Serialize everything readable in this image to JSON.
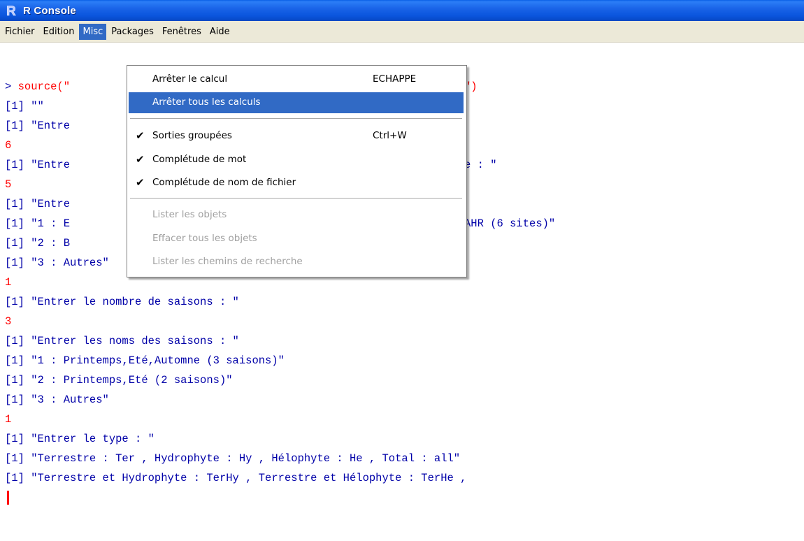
{
  "window": {
    "title": "R Console",
    "icon": "r-logo-icon"
  },
  "menubar": {
    "items": [
      {
        "label": "Fichier"
      },
      {
        "label": "Edition"
      },
      {
        "label": "Misc"
      },
      {
        "label": "Packages"
      },
      {
        "label": "Fenêtres"
      },
      {
        "label": "Aide"
      }
    ]
  },
  "misc_menu": {
    "items": [
      {
        "label": "Arrêter le calcul",
        "shortcut": "ECHAPPE"
      },
      {
        "label": "Arrêter tous les calculs"
      },
      {
        "label": "Sorties groupées",
        "shortcut": "Ctrl+W",
        "checked": true
      },
      {
        "label": "Complétude de mot",
        "checked": true
      },
      {
        "label": "Complétude de nom de fichier",
        "checked": true
      },
      {
        "label": "Lister les objets",
        "disabled": true
      },
      {
        "label": "Effacer tous les objets",
        "disabled": true
      },
      {
        "label": "Lister les chemins de recherche",
        "disabled": true
      }
    ]
  },
  "console": {
    "lines": [
      {
        "text": "> source(\"",
        "suffix": "\")"
      },
      {
        "text": "[1] \"\""
      },
      {
        "text": "[1] \"Entre"
      },
      {
        "text": "6"
      },
      {
        "text": "[1] \"Entre",
        "suffix": "e : \""
      },
      {
        "text": "5"
      },
      {
        "text": "[1] \"Entre"
      },
      {
        "text": "[1] \"1 : E",
        "suffix": "AHR (6 sites)\""
      },
      {
        "text": "[1] \"2 : B"
      },
      {
        "text": "[1] \"3 : Autres\""
      },
      {
        "text": "1"
      },
      {
        "text": "[1] \"Entrer le nombre de saisons : \""
      },
      {
        "text": "3"
      },
      {
        "text": "[1] \"Entrer les noms des saisons : \""
      },
      {
        "text": "[1] \"1 : Printemps,Eté,Automne (3 saisons)\""
      },
      {
        "text": "[1] \"2 : Printemps,Eté (2 saisons)\""
      },
      {
        "text": "[1] \"3 : Autres\""
      },
      {
        "text": "1"
      },
      {
        "text": "[1] \"Entrer le type : \""
      },
      {
        "text": "[1] \"Terrestre : Ter , Hydrophyte : Hy , Hélophyte : He , Total : all\""
      },
      {
        "text": "[1] \"Terrestre et Hydrophyte : TerHy , Terrestre et Hélophyte : TerHe ,"
      }
    ]
  },
  "colors": {
    "output": "#0000a8",
    "input": "#ff0000",
    "menu_highlight": "#316ac5",
    "titlebar": "#0a55dd"
  }
}
